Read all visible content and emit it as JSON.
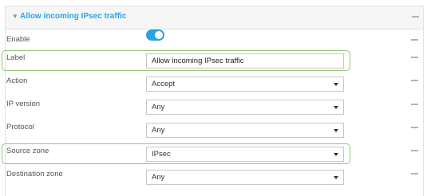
{
  "header": {
    "toggle_glyph": "▼",
    "title": "Allow incoming IPsec traffic"
  },
  "fields": {
    "enable": {
      "label": "Enable",
      "state": "on"
    },
    "label": {
      "label": "Label",
      "value": "Allow incoming IPsec traffic"
    },
    "action": {
      "label": "Action",
      "value": "Accept"
    },
    "ip_version": {
      "label": "IP version",
      "value": "Any"
    },
    "protocol": {
      "label": "Protocol",
      "value": "Any"
    },
    "source_zone": {
      "label": "Source zone",
      "value": "IPsec"
    },
    "destination_zone": {
      "label": "Destination zone",
      "value": "Any"
    }
  },
  "icons": {
    "row_menu": "more-dots-icon",
    "dropdown": "caret-down-icon"
  },
  "colors": {
    "accent": "#2ba3dc",
    "highlight": "#93c77a"
  }
}
